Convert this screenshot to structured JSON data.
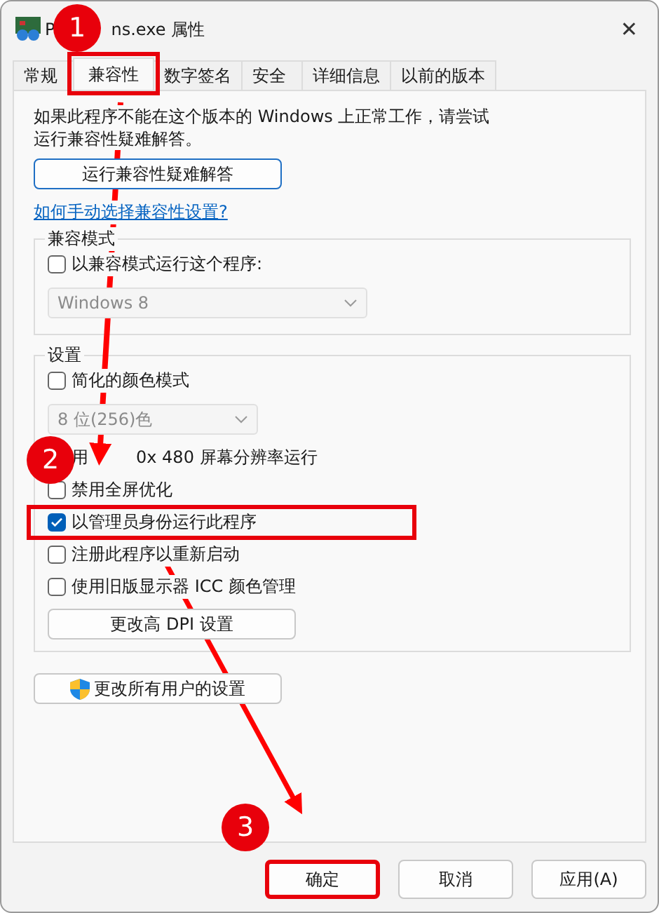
{
  "window": {
    "title_start": "P",
    "title_end": "ns.exe 属性",
    "close": "✕"
  },
  "tabs": [
    {
      "label": "常规",
      "selected": false,
      "highlighted": false
    },
    {
      "label": "兼容性",
      "selected": true,
      "highlighted": true
    },
    {
      "label": "数字签名",
      "selected": false,
      "highlighted": false
    },
    {
      "label": "安全",
      "selected": false,
      "highlighted": false
    },
    {
      "label": "详细信息",
      "selected": false,
      "highlighted": false
    },
    {
      "label": "以前的版本",
      "selected": false,
      "highlighted": false
    }
  ],
  "intro": "如果此程序不能在这个版本的 Windows 上正常工作，请尝试运行兼容性疑难解答。",
  "troubleshoot_button": "运行兼容性疑难解答",
  "help_link": "如何手动选择兼容性设置?",
  "compat_mode": {
    "title": "兼容模式",
    "checkbox": {
      "label": "以兼容模式运行这个程序:",
      "checked": false
    },
    "select": {
      "value": "Windows 8",
      "disabled": true
    }
  },
  "settings": {
    "title": "设置",
    "items": [
      {
        "kind": "checkbox",
        "label": "简化的颜色模式",
        "checked": false,
        "highlighted": false
      },
      {
        "kind": "select",
        "value": "8 位(256)色",
        "disabled": true
      },
      {
        "kind": "partial",
        "label_start": "用",
        "label_end": "0x 480 屏幕分辨率运行"
      },
      {
        "kind": "checkbox",
        "label": "禁用全屏优化",
        "checked": false,
        "highlighted": false
      },
      {
        "kind": "checkbox",
        "label": "以管理员身份运行此程序",
        "checked": true,
        "highlighted": true
      },
      {
        "kind": "checkbox",
        "label": "注册此程序以重新启动",
        "checked": false,
        "highlighted": false
      },
      {
        "kind": "checkbox",
        "label": "使用旧版显示器 ICC 颜色管理",
        "checked": false,
        "highlighted": false
      },
      {
        "kind": "button",
        "label": "更改高 DPI 设置"
      }
    ]
  },
  "all_users_button": "更改所有用户的设置",
  "buttons": [
    {
      "label": "确定",
      "highlighted": true
    },
    {
      "label": "取消",
      "highlighted": false
    },
    {
      "label": "应用(A)",
      "highlighted": false
    }
  ],
  "annotations": [
    "1",
    "2",
    "3"
  ]
}
